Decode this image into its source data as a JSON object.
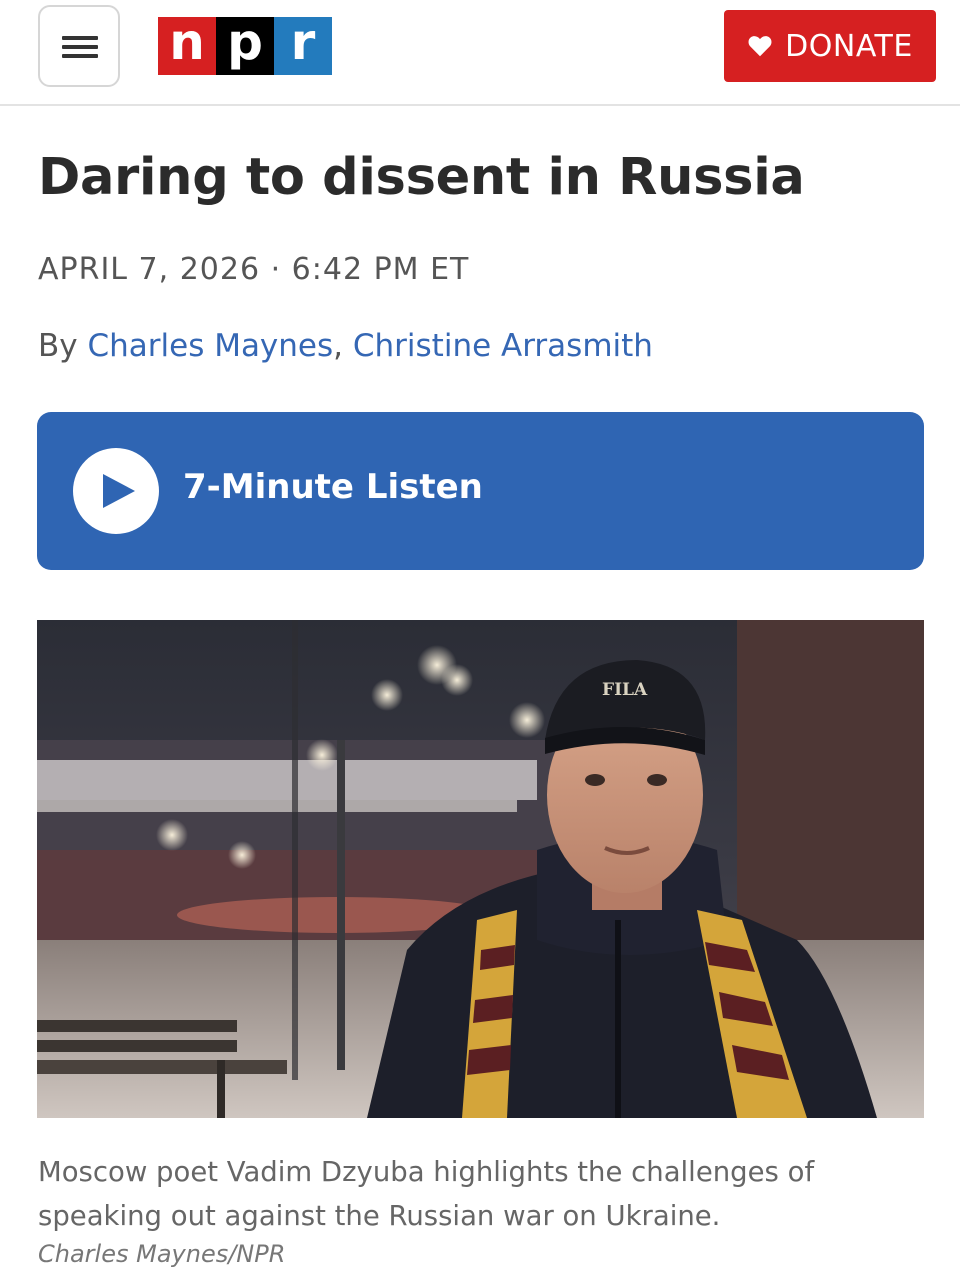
{
  "header": {
    "menu_icon": "hamburger-icon",
    "logo": {
      "letters": [
        "n",
        "p",
        "r"
      ],
      "colors": [
        "#d62021",
        "#000000",
        "#237bbd"
      ]
    },
    "donate_label": "DONATE",
    "donate_icon": "heart-icon",
    "donate_color": "#d62021"
  },
  "article": {
    "title": "Daring to dissent in Russia",
    "dateline": "APRIL 7, 2026 · 6:42 PM ET",
    "byline_prefix": "By ",
    "authors": [
      "Charles Maynes",
      "Christine Arrasmith"
    ],
    "author_separator": ", ",
    "author_color": "#3567b4"
  },
  "audio": {
    "label": "7-Minute Listen",
    "icon": "play-icon",
    "color": "#2f65b3"
  },
  "photo": {
    "cap_text": "FILA",
    "caption": "Moscow poet Vadim Dzyuba highlights the challenges of speaking out against the Russian war on Ukraine.",
    "credit": "Charles Maynes/NPR"
  }
}
